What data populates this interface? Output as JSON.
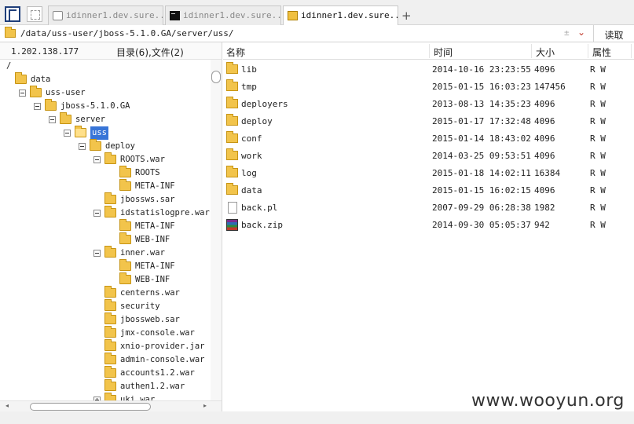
{
  "tabs": [
    {
      "label": "idinner1.dev.sure...",
      "icon": "document-icon",
      "active": false
    },
    {
      "label": "idinner1.dev.sure...",
      "icon": "terminal-icon",
      "active": false
    },
    {
      "label": "idinner1.dev.sure...",
      "icon": "folder-icon",
      "active": true
    }
  ],
  "new_tab_label": "+",
  "path": {
    "value": "/data/uss-user/jboss-5.1.0.GA/server/uss/",
    "marker": "±",
    "read_button": "读取"
  },
  "info": {
    "ip": "1.202.138.177",
    "counts": "目录(6),文件(2)"
  },
  "tree": [
    {
      "label": "/",
      "depth": 0,
      "expander": "none",
      "folder": false
    },
    {
      "label": "data",
      "depth": 0,
      "expander": "none",
      "folder": true
    },
    {
      "label": "uss-user",
      "depth": 1,
      "expander": "minus",
      "folder": true
    },
    {
      "label": "jboss-5.1.0.GA",
      "depth": 2,
      "expander": "minus",
      "folder": true
    },
    {
      "label": "server",
      "depth": 3,
      "expander": "minus",
      "folder": true
    },
    {
      "label": "uss",
      "depth": 4,
      "expander": "minus",
      "folder": true,
      "selected": true
    },
    {
      "label": "deploy",
      "depth": 5,
      "expander": "minus",
      "folder": true
    },
    {
      "label": "ROOTS.war",
      "depth": 6,
      "expander": "minus",
      "folder": true
    },
    {
      "label": "ROOTS",
      "depth": 7,
      "expander": "none",
      "folder": true
    },
    {
      "label": "META-INF",
      "depth": 7,
      "expander": "none",
      "folder": true
    },
    {
      "label": "jbossws.sar",
      "depth": 6,
      "expander": "none",
      "folder": true
    },
    {
      "label": "idstatislogpre.war",
      "depth": 6,
      "expander": "minus",
      "folder": true
    },
    {
      "label": "META-INF",
      "depth": 7,
      "expander": "none",
      "folder": true
    },
    {
      "label": "WEB-INF",
      "depth": 7,
      "expander": "none",
      "folder": true
    },
    {
      "label": "inner.war",
      "depth": 6,
      "expander": "minus",
      "folder": true
    },
    {
      "label": "META-INF",
      "depth": 7,
      "expander": "none",
      "folder": true
    },
    {
      "label": "WEB-INF",
      "depth": 7,
      "expander": "none",
      "folder": true
    },
    {
      "label": "centerns.war",
      "depth": 6,
      "expander": "none",
      "folder": true
    },
    {
      "label": "security",
      "depth": 6,
      "expander": "none",
      "folder": true
    },
    {
      "label": "jbossweb.sar",
      "depth": 6,
      "expander": "none",
      "folder": true
    },
    {
      "label": "jmx-console.war",
      "depth": 6,
      "expander": "none",
      "folder": true
    },
    {
      "label": "xnio-provider.jar",
      "depth": 6,
      "expander": "none",
      "folder": true
    },
    {
      "label": "admin-console.war",
      "depth": 6,
      "expander": "none",
      "folder": true
    },
    {
      "label": "accounts1.2.war",
      "depth": 6,
      "expander": "none",
      "folder": true
    },
    {
      "label": "authen1.2.war",
      "depth": 6,
      "expander": "none",
      "folder": true
    },
    {
      "label": "uki.war",
      "depth": 6,
      "expander": "plus",
      "folder": true
    }
  ],
  "columns": {
    "name": "名称",
    "time": "时间",
    "size": "大小",
    "attr": "属性"
  },
  "files": [
    {
      "name": "lib",
      "time": "2014-10-16 23:23:55",
      "size": "4096",
      "attr": "R W",
      "icon": "folder-icon"
    },
    {
      "name": "tmp",
      "time": "2015-01-15 16:03:23",
      "size": "147456",
      "attr": "R W",
      "icon": "folder-icon"
    },
    {
      "name": "deployers",
      "time": "2013-08-13 14:35:23",
      "size": "4096",
      "attr": "R W",
      "icon": "folder-icon"
    },
    {
      "name": "deploy",
      "time": "2015-01-17 17:32:48",
      "size": "4096",
      "attr": "R W",
      "icon": "folder-icon"
    },
    {
      "name": "conf",
      "time": "2015-01-14 18:43:02",
      "size": "4096",
      "attr": "R W",
      "icon": "folder-icon"
    },
    {
      "name": "work",
      "time": "2014-03-25 09:53:51",
      "size": "4096",
      "attr": "R W",
      "icon": "folder-icon"
    },
    {
      "name": "log",
      "time": "2015-01-18 14:02:11",
      "size": "16384",
      "attr": "R W",
      "icon": "folder-icon"
    },
    {
      "name": "data",
      "time": "2015-01-15 16:02:15",
      "size": "4096",
      "attr": "R W",
      "icon": "folder-icon"
    },
    {
      "name": "back.pl",
      "time": "2007-09-29 06:28:38",
      "size": "1982",
      "attr": "R W",
      "icon": "file-icon"
    },
    {
      "name": "back.zip",
      "time": "2014-09-30 05:05:37",
      "size": "942",
      "attr": "R W",
      "icon": "archive-icon"
    }
  ],
  "watermark": "www.wooyun.org"
}
